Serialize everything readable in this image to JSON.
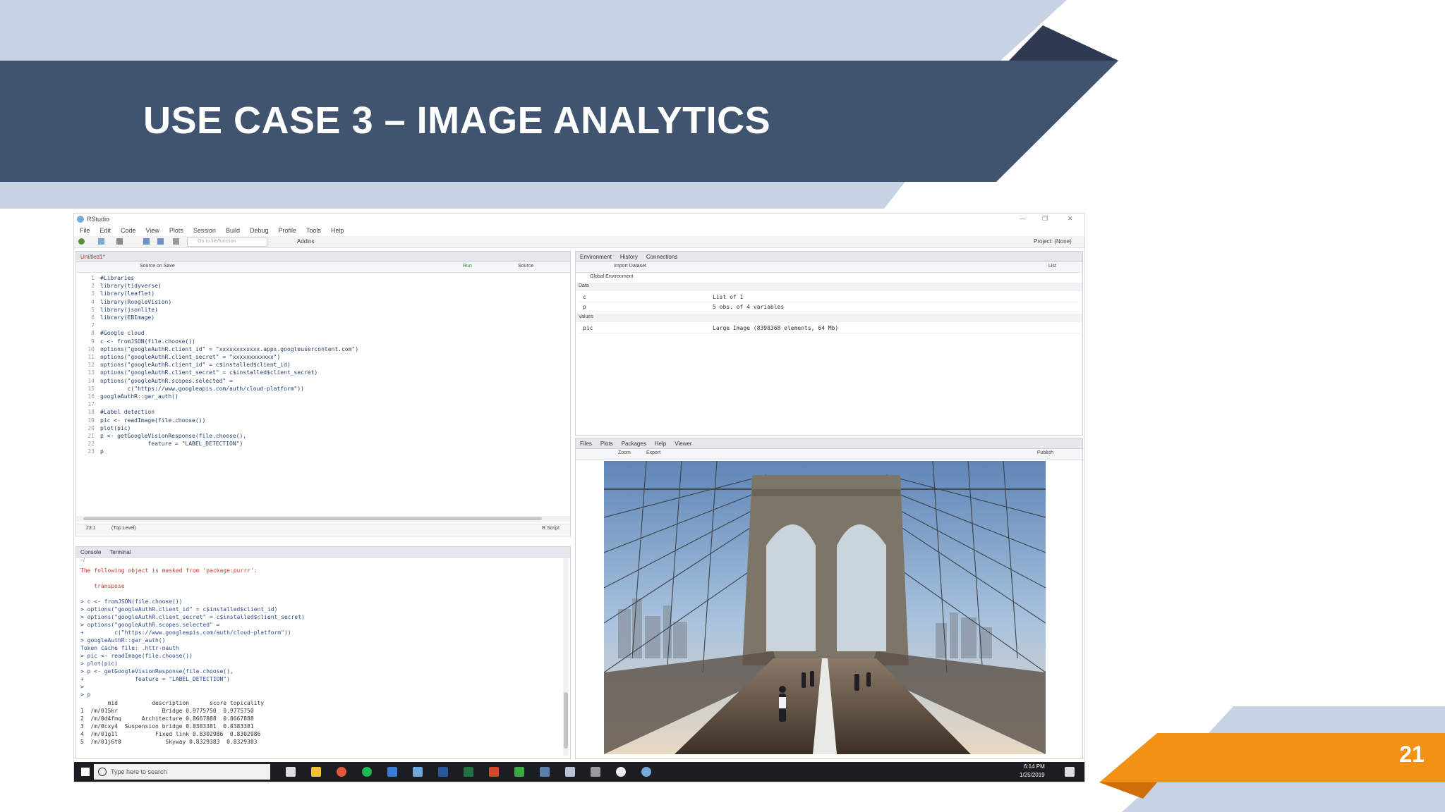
{
  "slide": {
    "title": "USE CASE 3 – IMAGE ANALYTICS",
    "page_number": "21",
    "colors": {
      "banner_dark": "#41546f",
      "banner_light": "#c7d3e3",
      "banner_shadow": "#2d3a52",
      "accent_orange": "#f39114",
      "accent_orange_dark": "#cf6d06"
    }
  },
  "rstudio": {
    "window_title": "RStudio",
    "menu": [
      "File",
      "Edit",
      "Code",
      "View",
      "Plots",
      "Session",
      "Build",
      "Debug",
      "Profile",
      "Tools",
      "Help"
    ],
    "toolbar": {
      "goto_placeholder": "Go to file/function",
      "addins_label": "Addins",
      "project_label": "Project: (None)"
    },
    "source": {
      "file_tab": "Untitled1*",
      "source_on_save": "Source on Save",
      "run_label": "Run",
      "source_label": "Source",
      "line_numbers": "1\n2\n3\n4\n5\n6\n7\n8\n9\n10\n11\n12\n13\n14\n15\n16\n17\n18\n19\n20\n21\n22\n23",
      "code": "#Libraries\nlibrary(tidyverse)\nlibrary(leaflet)\nlibrary(RoogleVision)\nlibrary(jsonlite)\nlibrary(EBImage)\n\n#Google cloud\nc <- fromJSON(file.choose())\noptions(\"googleAuthR.client_id\" = \"xxxxxxxxxxxx.apps.googleusercontent.com\")\noptions(\"googleAuthR.client_secret\" = \"xxxxxxxxxxxx\")\noptions(\"googleAuthR.client_id\" = c$installed$client_id)\noptions(\"googleAuthR.client_secret\" = c$installed$client_secret)\noptions(\"googleAuthR.scopes.selected\" =\n        c(\"https://www.googleapis.com/auth/cloud-platform\"))\ngoogleAuthR::gar_auth()\n\n#Label detection\npic <- readImage(file.choose())\nplot(pic)\np <- getGoogleVisionResponse(file.choose(),\n              feature = \"LABEL_DETECTION\")\np",
      "status_position": "23:1",
      "status_scope": "(Top Level)",
      "status_type": "R Script"
    },
    "console": {
      "tabs": [
        "Console",
        "Terminal"
      ],
      "path": "~/",
      "warning_lines": "The following object is masked from 'package:purrr':\n\n    transpose",
      "command_lines": "> c <- fromJSON(file.choose())\n> options(\"googleAuthR.client_id\" = c$installed$client_id)\n> options(\"googleAuthR.client_secret\" = c$installed$client_secret)\n> options(\"googleAuthR.scopes.selected\" =\n+         c(\"https://www.googleapis.com/auth/cloud-platform\"))\n> googleAuthR::gar_auth()\nToken cache file: .httr-oauth\n> pic <- readImage(file.choose())\n> plot(pic)\n> p <- getGoogleVisionResponse(file.choose(),\n+               feature = \"LABEL_DETECTION\")\n>\n> p",
      "result_lines": "        mid          description      score topicality\n1  /m/015kr             Bridge 0.9775750  0.9775750\n2  /m/0d4fmq      Architecture 0.8667888  0.8667888\n3  /m/0cxy4  Suspension bridge 0.8383381  0.8383381\n4  /m/01g1l           Fixed link 0.8302986  0.8302986\n5  /m/01j6t0             Skyway 0.8329383  0.8329383"
    },
    "environment": {
      "tabs": [
        "Environment",
        "History",
        "Connections"
      ],
      "import_label": "Import Dataset",
      "list_label": "List",
      "scope_label": "Global Environment",
      "data_header": "Data",
      "values_header": "Values",
      "rows": [
        {
          "name": "c",
          "value": "List of 1"
        },
        {
          "name": "p",
          "value": "5 obs. of 4 variables"
        }
      ],
      "values": [
        {
          "name": "pic",
          "value": "Large Image (8398368 elements, 64 Mb)"
        }
      ]
    },
    "viewer": {
      "tabs": [
        "Files",
        "Plots",
        "Packages",
        "Help",
        "Viewer"
      ],
      "zoom_label": "Zoom",
      "export_label": "Export",
      "publish_label": "Publish"
    },
    "taskbar": {
      "search_placeholder": "Type here to search",
      "time": "6:14 PM",
      "date": "1/25/2019"
    }
  }
}
